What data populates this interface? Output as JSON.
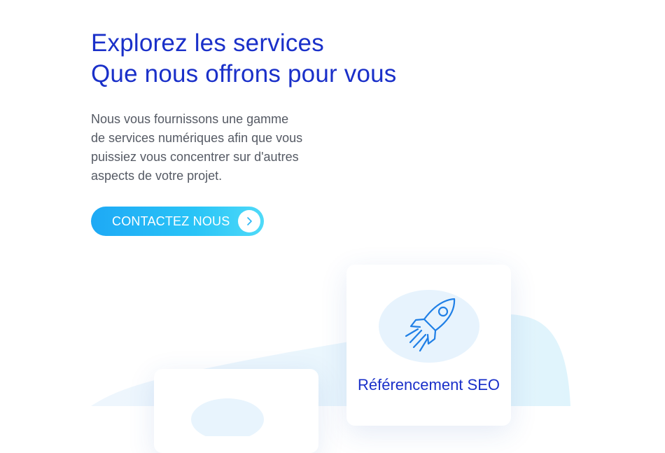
{
  "hero": {
    "title_line1": "Explorez les services",
    "title_line2": "Que nous offrons pour vous",
    "description_lines": [
      "Nous vous fournissons une gamme",
      "de services numériques afin que vous",
      "puissiez vous concentrer sur d'autres",
      "aspects de votre projet."
    ],
    "cta_label": "CONTACTEZ NOUS",
    "cta_icon": "chevron-right-icon"
  },
  "services": [
    {
      "title": "Référencement SEO",
      "icon": "rocket-icon"
    },
    {
      "title": "",
      "icon": "service-icon"
    }
  ],
  "colors": {
    "heading": "#1a30c9",
    "text": "#555a64",
    "accent_start": "#1ea9f5",
    "accent_end": "#4fdaf8",
    "blob": "#e6f7fd"
  }
}
